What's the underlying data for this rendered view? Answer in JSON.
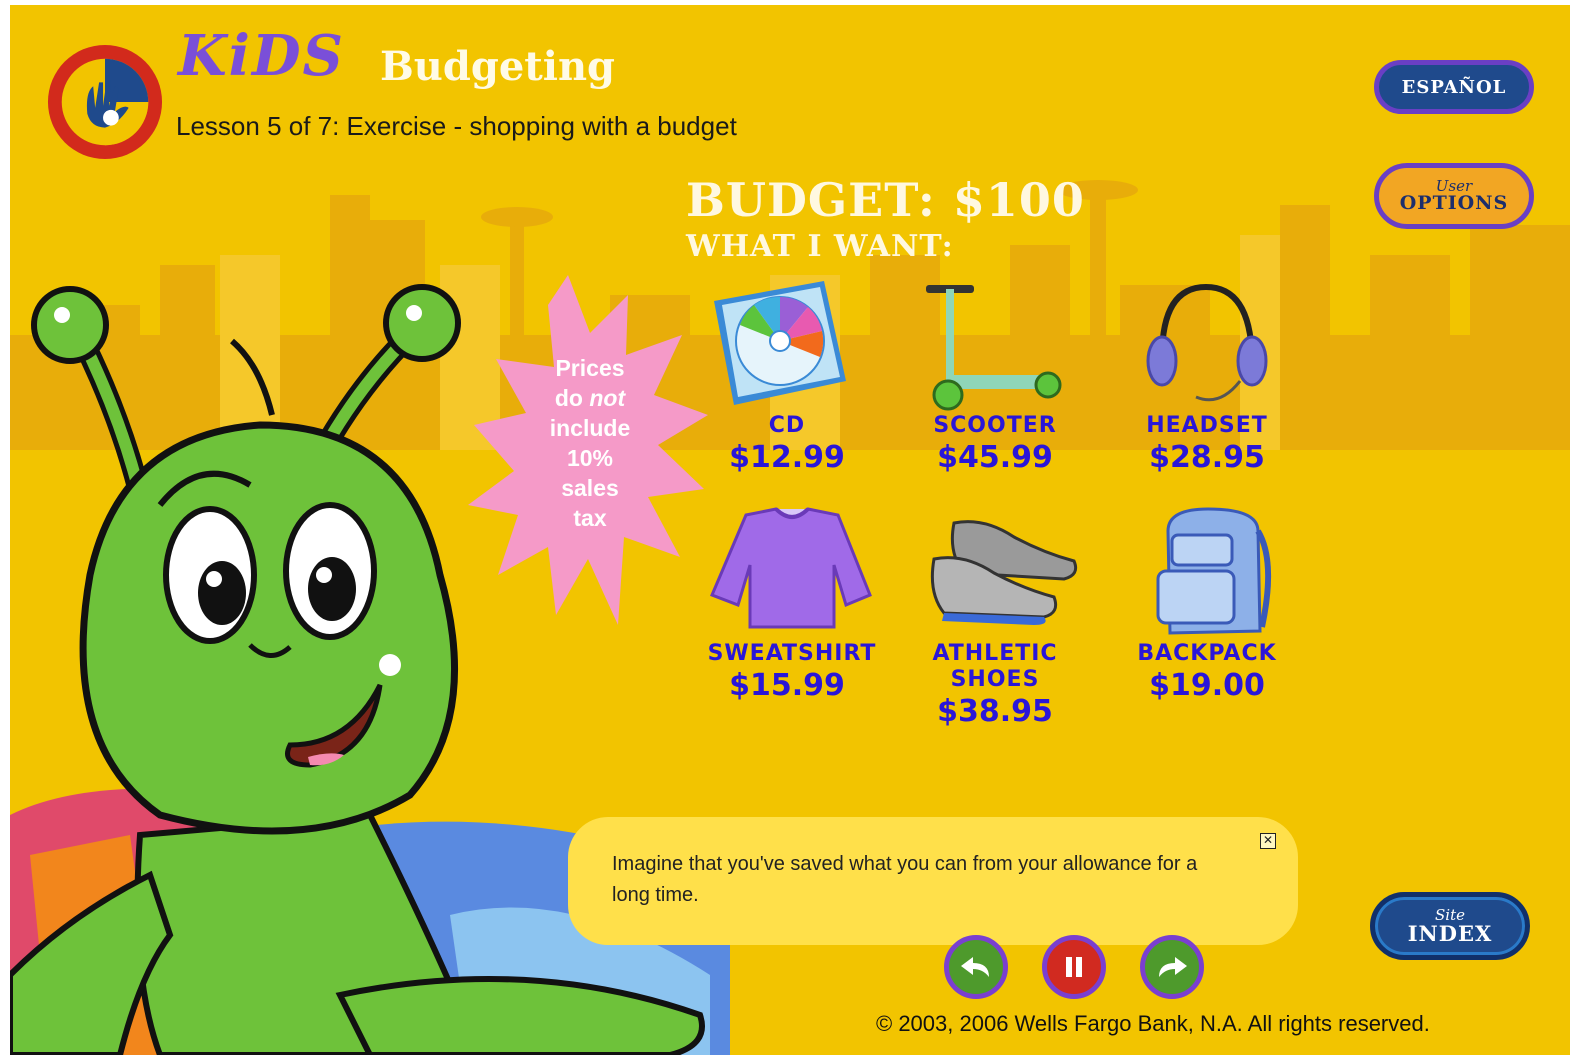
{
  "header": {
    "brand": "KiDS",
    "section": "Budgeting",
    "lesson": "Lesson 5 of 7: Exercise - shopping with a budget"
  },
  "buttons": {
    "espanol": "ESPAÑOL",
    "options_small": "User",
    "options_big": "OPTIONS",
    "index_small": "Site",
    "index_big": "INDEX"
  },
  "budget": {
    "title": "BUDGET: $100",
    "subtitle": "WHAT I WANT:"
  },
  "note": {
    "line1": "Prices",
    "line2a": "do ",
    "line2b": "not",
    "line3": "include",
    "line4": "10%",
    "line5": "sales",
    "line6": "tax"
  },
  "products": [
    {
      "name": "CD",
      "price": "$12.99"
    },
    {
      "name": "SCOOTER",
      "price": "$45.99"
    },
    {
      "name": "HEADSET",
      "price": "$28.95"
    },
    {
      "name": "SWEATSHIRT",
      "price": "$15.99"
    },
    {
      "name": "ATHLETIC",
      "name2": "SHOES",
      "price": "$38.95"
    },
    {
      "name": "BACKPACK",
      "price": "$19.00"
    }
  ],
  "speech": {
    "text": "Imagine that you've saved what you can from your allowance for a long time.",
    "close": "✕"
  },
  "footer": {
    "copyright": "© 2003, 2006 Wells Fargo Bank, N.A. All rights reserved."
  },
  "colors": {
    "background": "#f2c400",
    "price_blue": "#2a16d8",
    "brand_purple": "#7a4fd8",
    "starburst_pink": "#f59ac8"
  }
}
